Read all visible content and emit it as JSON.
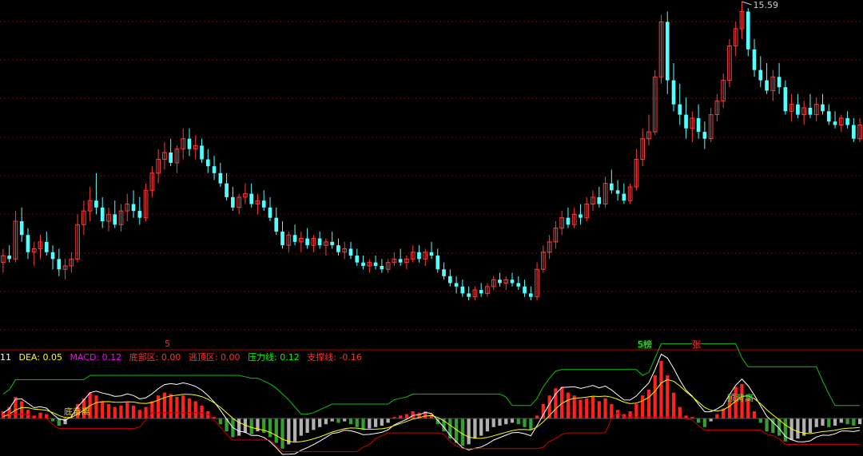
{
  "chart_data": {
    "type": "candlestick",
    "price_high_label": "15.59",
    "candles": [
      [
        8.0,
        8.4,
        7.7,
        8.2
      ],
      [
        8.2,
        8.5,
        8.0,
        8.1
      ],
      [
        8.1,
        9.5,
        8.0,
        9.2
      ],
      [
        9.2,
        9.6,
        8.6,
        8.8
      ],
      [
        8.8,
        9.0,
        8.1,
        8.3
      ],
      [
        8.3,
        8.6,
        7.9,
        8.4
      ],
      [
        8.4,
        8.8,
        8.1,
        8.6
      ],
      [
        8.6,
        8.9,
        8.2,
        8.3
      ],
      [
        8.3,
        8.5,
        7.8,
        8.1
      ],
      [
        8.1,
        8.4,
        7.6,
        7.8
      ],
      [
        7.8,
        8.1,
        7.5,
        7.9
      ],
      [
        7.9,
        8.3,
        7.7,
        8.1
      ],
      [
        8.1,
        9.4,
        8.0,
        9.1
      ],
      [
        9.1,
        9.8,
        8.8,
        9.5
      ],
      [
        9.5,
        10.2,
        9.2,
        9.8
      ],
      [
        9.8,
        10.6,
        9.4,
        9.6
      ],
      [
        9.6,
        9.9,
        9.0,
        9.2
      ],
      [
        9.2,
        9.6,
        8.9,
        9.4
      ],
      [
        9.4,
        9.8,
        9.0,
        9.1
      ],
      [
        9.1,
        9.7,
        8.9,
        9.5
      ],
      [
        9.5,
        10.0,
        9.2,
        9.7
      ],
      [
        9.7,
        10.1,
        9.3,
        9.5
      ],
      [
        9.5,
        9.9,
        9.1,
        9.3
      ],
      [
        9.3,
        10.3,
        9.2,
        10.1
      ],
      [
        10.1,
        10.8,
        9.9,
        10.6
      ],
      [
        10.6,
        11.3,
        10.3,
        11.0
      ],
      [
        11.0,
        11.5,
        10.7,
        11.2
      ],
      [
        11.2,
        11.6,
        10.8,
        10.9
      ],
      [
        10.9,
        11.4,
        10.6,
        11.3
      ],
      [
        11.3,
        11.9,
        11.0,
        11.6
      ],
      [
        11.6,
        11.9,
        11.1,
        11.3
      ],
      [
        11.3,
        11.7,
        11.0,
        11.4
      ],
      [
        11.4,
        11.6,
        10.9,
        11.0
      ],
      [
        11.0,
        11.3,
        10.6,
        10.8
      ],
      [
        10.8,
        11.1,
        10.4,
        10.6
      ],
      [
        10.6,
        10.9,
        10.2,
        10.3
      ],
      [
        10.3,
        10.6,
        9.8,
        9.9
      ],
      [
        9.9,
        10.2,
        9.5,
        9.6
      ],
      [
        9.6,
        10.0,
        9.4,
        9.9
      ],
      [
        9.9,
        10.3,
        9.7,
        10.0
      ],
      [
        10.0,
        10.3,
        9.6,
        9.7
      ],
      [
        9.7,
        10.0,
        9.4,
        9.8
      ],
      [
        9.8,
        10.1,
        9.5,
        9.6
      ],
      [
        9.6,
        9.9,
        9.2,
        9.3
      ],
      [
        9.3,
        9.6,
        8.8,
        8.9
      ],
      [
        8.9,
        9.2,
        8.4,
        8.5
      ],
      [
        8.5,
        8.9,
        8.3,
        8.8
      ],
      [
        8.8,
        9.1,
        8.5,
        8.6
      ],
      [
        8.6,
        8.9,
        8.3,
        8.7
      ],
      [
        8.7,
        9.0,
        8.4,
        8.5
      ],
      [
        8.5,
        8.8,
        8.3,
        8.7
      ],
      [
        8.7,
        8.9,
        8.4,
        8.5
      ],
      [
        8.5,
        8.7,
        8.2,
        8.6
      ],
      [
        8.6,
        8.9,
        8.4,
        8.5
      ],
      [
        8.5,
        8.7,
        8.2,
        8.3
      ],
      [
        8.3,
        8.6,
        8.1,
        8.4
      ],
      [
        8.4,
        8.6,
        8.1,
        8.2
      ],
      [
        8.2,
        8.4,
        7.9,
        8.0
      ],
      [
        8.0,
        8.2,
        7.8,
        7.9
      ],
      [
        7.9,
        8.1,
        7.7,
        8.0
      ],
      [
        8.0,
        8.2,
        7.8,
        7.9
      ],
      [
        7.9,
        8.1,
        7.7,
        7.8
      ],
      [
        7.8,
        8.1,
        7.7,
        8.0
      ],
      [
        8.0,
        8.3,
        7.9,
        8.1
      ],
      [
        8.1,
        8.4,
        7.9,
        8.0
      ],
      [
        8.0,
        8.2,
        7.8,
        8.1
      ],
      [
        8.1,
        8.5,
        8.0,
        8.3
      ],
      [
        8.3,
        8.5,
        8.0,
        8.1
      ],
      [
        8.1,
        8.4,
        7.9,
        8.3
      ],
      [
        8.3,
        8.6,
        8.1,
        8.2
      ],
      [
        8.2,
        8.4,
        7.7,
        7.8
      ],
      [
        7.8,
        8.0,
        7.5,
        7.6
      ],
      [
        7.6,
        7.8,
        7.3,
        7.4
      ],
      [
        7.4,
        7.6,
        7.1,
        7.3
      ],
      [
        7.3,
        7.5,
        7.0,
        7.1
      ],
      [
        7.1,
        7.3,
        6.9,
        7.0
      ],
      [
        7.0,
        7.3,
        6.9,
        7.2
      ],
      [
        7.2,
        7.4,
        7.0,
        7.1
      ],
      [
        7.1,
        7.4,
        7.0,
        7.3
      ],
      [
        7.3,
        7.6,
        7.2,
        7.5
      ],
      [
        7.5,
        7.7,
        7.3,
        7.4
      ],
      [
        7.4,
        7.6,
        7.2,
        7.5
      ],
      [
        7.5,
        7.7,
        7.3,
        7.4
      ],
      [
        7.4,
        7.6,
        7.2,
        7.3
      ],
      [
        7.3,
        7.5,
        7.0,
        7.1
      ],
      [
        7.1,
        7.3,
        6.9,
        7.0
      ],
      [
        7.0,
        8.0,
        6.9,
        7.8
      ],
      [
        7.8,
        8.5,
        7.7,
        8.3
      ],
      [
        8.3,
        8.8,
        8.1,
        8.6
      ],
      [
        8.6,
        9.2,
        8.4,
        9.0
      ],
      [
        9.0,
        9.5,
        8.8,
        9.3
      ],
      [
        9.3,
        9.6,
        9.0,
        9.1
      ],
      [
        9.1,
        9.6,
        9.0,
        9.4
      ],
      [
        9.4,
        9.7,
        9.1,
        9.3
      ],
      [
        9.3,
        9.9,
        9.2,
        9.7
      ],
      [
        9.7,
        10.1,
        9.5,
        9.9
      ],
      [
        9.9,
        10.2,
        9.6,
        9.7
      ],
      [
        9.7,
        10.5,
        9.6,
        10.3
      ],
      [
        10.3,
        10.7,
        10.0,
        10.1
      ],
      [
        10.1,
        10.4,
        9.8,
        10.0
      ],
      [
        10.0,
        10.3,
        9.7,
        9.8
      ],
      [
        9.8,
        10.3,
        9.7,
        10.2
      ],
      [
        10.2,
        11.3,
        10.1,
        11.0
      ],
      [
        11.0,
        11.9,
        10.8,
        11.6
      ],
      [
        11.6,
        12.3,
        11.4,
        11.8
      ],
      [
        11.8,
        13.6,
        11.7,
        13.4
      ],
      [
        13.4,
        15.2,
        13.2,
        15.0
      ],
      [
        15.0,
        15.3,
        12.9,
        13.3
      ],
      [
        13.3,
        13.8,
        12.4,
        12.6
      ],
      [
        12.6,
        13.2,
        12.0,
        12.3
      ],
      [
        12.3,
        12.8,
        11.6,
        11.9
      ],
      [
        11.9,
        12.4,
        11.5,
        12.2
      ],
      [
        12.2,
        12.6,
        11.6,
        11.8
      ],
      [
        11.8,
        12.1,
        11.3,
        11.6
      ],
      [
        11.6,
        12.5,
        11.5,
        12.3
      ],
      [
        12.3,
        12.9,
        12.1,
        12.7
      ],
      [
        12.7,
        13.5,
        12.5,
        13.3
      ],
      [
        13.3,
        14.5,
        13.1,
        14.3
      ],
      [
        14.3,
        15.0,
        14.0,
        14.8
      ],
      [
        14.8,
        15.59,
        14.5,
        15.3
      ],
      [
        15.3,
        15.4,
        14.0,
        14.2
      ],
      [
        14.2,
        14.5,
        13.4,
        13.6
      ],
      [
        13.6,
        14.0,
        13.1,
        13.3
      ],
      [
        13.3,
        13.8,
        12.9,
        13.0
      ],
      [
        13.0,
        13.6,
        12.7,
        13.4
      ],
      [
        13.4,
        13.8,
        12.9,
        13.1
      ],
      [
        13.1,
        13.3,
        12.3,
        12.4
      ],
      [
        12.4,
        12.9,
        12.1,
        12.6
      ],
      [
        12.6,
        12.9,
        12.2,
        12.3
      ],
      [
        12.3,
        12.7,
        12.0,
        12.5
      ],
      [
        12.5,
        12.9,
        12.2,
        12.3
      ],
      [
        12.3,
        12.8,
        12.1,
        12.6
      ],
      [
        12.6,
        12.9,
        12.3,
        12.4
      ],
      [
        12.4,
        12.6,
        12.0,
        12.1
      ],
      [
        12.1,
        12.4,
        11.9,
        12.0
      ],
      [
        12.0,
        12.3,
        11.8,
        12.2
      ],
      [
        12.2,
        12.4,
        11.9,
        12.0
      ],
      [
        12.0,
        12.2,
        11.5,
        11.6
      ],
      [
        11.6,
        12.2,
        11.5,
        12.0
      ]
    ],
    "macd": [
      0.05,
      0.08,
      0.15,
      0.12,
      0.06,
      0.02,
      0.04,
      0.03,
      -0.02,
      -0.05,
      -0.04,
      0.01,
      0.1,
      0.14,
      0.18,
      0.16,
      0.12,
      0.1,
      0.08,
      0.09,
      0.11,
      0.09,
      0.06,
      0.08,
      0.12,
      0.16,
      0.18,
      0.17,
      0.15,
      0.16,
      0.14,
      0.12,
      0.09,
      0.05,
      0.01,
      -0.04,
      -0.09,
      -0.13,
      -0.12,
      -0.1,
      -0.11,
      -0.09,
      -0.1,
      -0.13,
      -0.17,
      -0.21,
      -0.18,
      -0.16,
      -0.12,
      -0.1,
      -0.08,
      -0.06,
      -0.04,
      -0.02,
      -0.03,
      -0.02,
      -0.04,
      -0.06,
      -0.08,
      -0.07,
      -0.06,
      -0.05,
      -0.03,
      0.01,
      0.02,
      0.03,
      0.05,
      0.04,
      0.05,
      0.03,
      -0.04,
      -0.09,
      -0.14,
      -0.17,
      -0.19,
      -0.18,
      -0.14,
      -0.12,
      -0.09,
      -0.06,
      -0.05,
      -0.04,
      -0.03,
      -0.04,
      -0.06,
      -0.08,
      0.02,
      0.1,
      0.16,
      0.21,
      0.22,
      0.18,
      0.16,
      0.13,
      0.14,
      0.15,
      0.12,
      0.14,
      0.1,
      0.06,
      0.03,
      0.05,
      0.1,
      0.16,
      0.2,
      0.3,
      0.4,
      0.3,
      0.18,
      0.08,
      0.02,
      0.01,
      -0.03,
      -0.06,
      -0.02,
      0.03,
      0.07,
      0.16,
      0.22,
      0.24,
      0.14,
      0.05,
      -0.03,
      -0.09,
      -0.1,
      -0.12,
      -0.16,
      -0.15,
      -0.14,
      -0.12,
      -0.1,
      -0.06,
      -0.05,
      -0.06,
      -0.05,
      -0.03,
      -0.04,
      -0.05,
      -0.04
    ],
    "indicator_labels": {
      "prefix": "11",
      "dea": "DEA: 0.05",
      "macd": "MACD: 0.12",
      "bottom_zone": "底部区: 0.00",
      "top_escape_zone": "逃顶区: 0.00",
      "pressure_line": "压力线: 0.12",
      "support_line": "支撑线: -0.16"
    },
    "annotations": {
      "mark_left": "5",
      "mark_right_green": "5榜",
      "mark_right_red": "张",
      "lower_tag_1": "底背离",
      "lower_tag_2": "顶背离"
    }
  },
  "colors": {
    "up": "#ff3b3b",
    "down": "#54ffff",
    "grid": "#7a0000",
    "divider": "#b00000",
    "white_line": "#ffffff",
    "yellow_line": "#ffff00",
    "green_line": "#10c010",
    "red_line": "#d00000",
    "hist_pos": "#ff2020",
    "hist_neg": "#30a030",
    "hist_grey": "#b0b0b0",
    "dea_label": "#ffff00",
    "macd_label": "#ff00ff",
    "bottom_label": "#ff3030",
    "escape_label": "#ff3030",
    "pressure_label": "#00ff00",
    "support_label": "#ff3030"
  }
}
